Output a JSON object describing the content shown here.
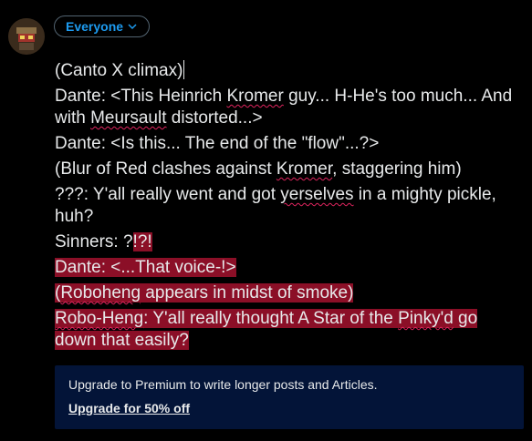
{
  "audience": {
    "label": "Everyone"
  },
  "post": {
    "lines": [
      {
        "segments": [
          {
            "text": "(Canto X climax)"
          }
        ],
        "caret": true
      },
      {
        "segments": [
          {
            "text": "Dante: <This Heinrich "
          },
          {
            "text": "Kromer",
            "squiggle": true
          },
          {
            "text": " guy... H-He's too much... And with "
          },
          {
            "text": "Meursault",
            "squiggle": true
          },
          {
            "text": " distorted...>"
          }
        ]
      },
      {
        "segments": [
          {
            "text": "Dante: <Is this... The end of the \"flow\"...?>"
          }
        ]
      },
      {
        "segments": [
          {
            "text": "(Blur of Red clashes against "
          },
          {
            "text": "Kromer",
            "squiggle": true
          },
          {
            "text": ", staggering him)"
          }
        ]
      },
      {
        "segments": [
          {
            "text": "???: Y'all really went and got "
          },
          {
            "text": "yerselves",
            "squiggle": true
          },
          {
            "text": " in a mighty pickle, huh?"
          }
        ]
      },
      {
        "segments": [
          {
            "text": "Sinners: ?"
          },
          {
            "text": "!?!",
            "highlight": true
          }
        ]
      },
      {
        "highlight": true,
        "segments": [
          {
            "text": "Dante: <...That voice-!>"
          }
        ]
      },
      {
        "highlight": true,
        "segments": [
          {
            "text": "("
          },
          {
            "text": "Roboheng",
            "squiggle": true
          },
          {
            "text": " appears in midst of smoke)"
          }
        ]
      },
      {
        "highlight": true,
        "segments": [
          {
            "text": "Robo-Heng",
            "squiggle": true
          },
          {
            "text": ": Y'all really thought A Star of the "
          },
          {
            "text": "Pinky'd",
            "squiggle": true
          },
          {
            "text": " go down that easily?"
          }
        ]
      }
    ]
  },
  "promo": {
    "text": "Upgrade to Premium to write longer posts and Articles.",
    "link": "Upgrade for 50% off"
  },
  "colors": {
    "accent": "#1d9bf0",
    "highlight": "#8b0f27",
    "promo_bg": "#031438"
  }
}
